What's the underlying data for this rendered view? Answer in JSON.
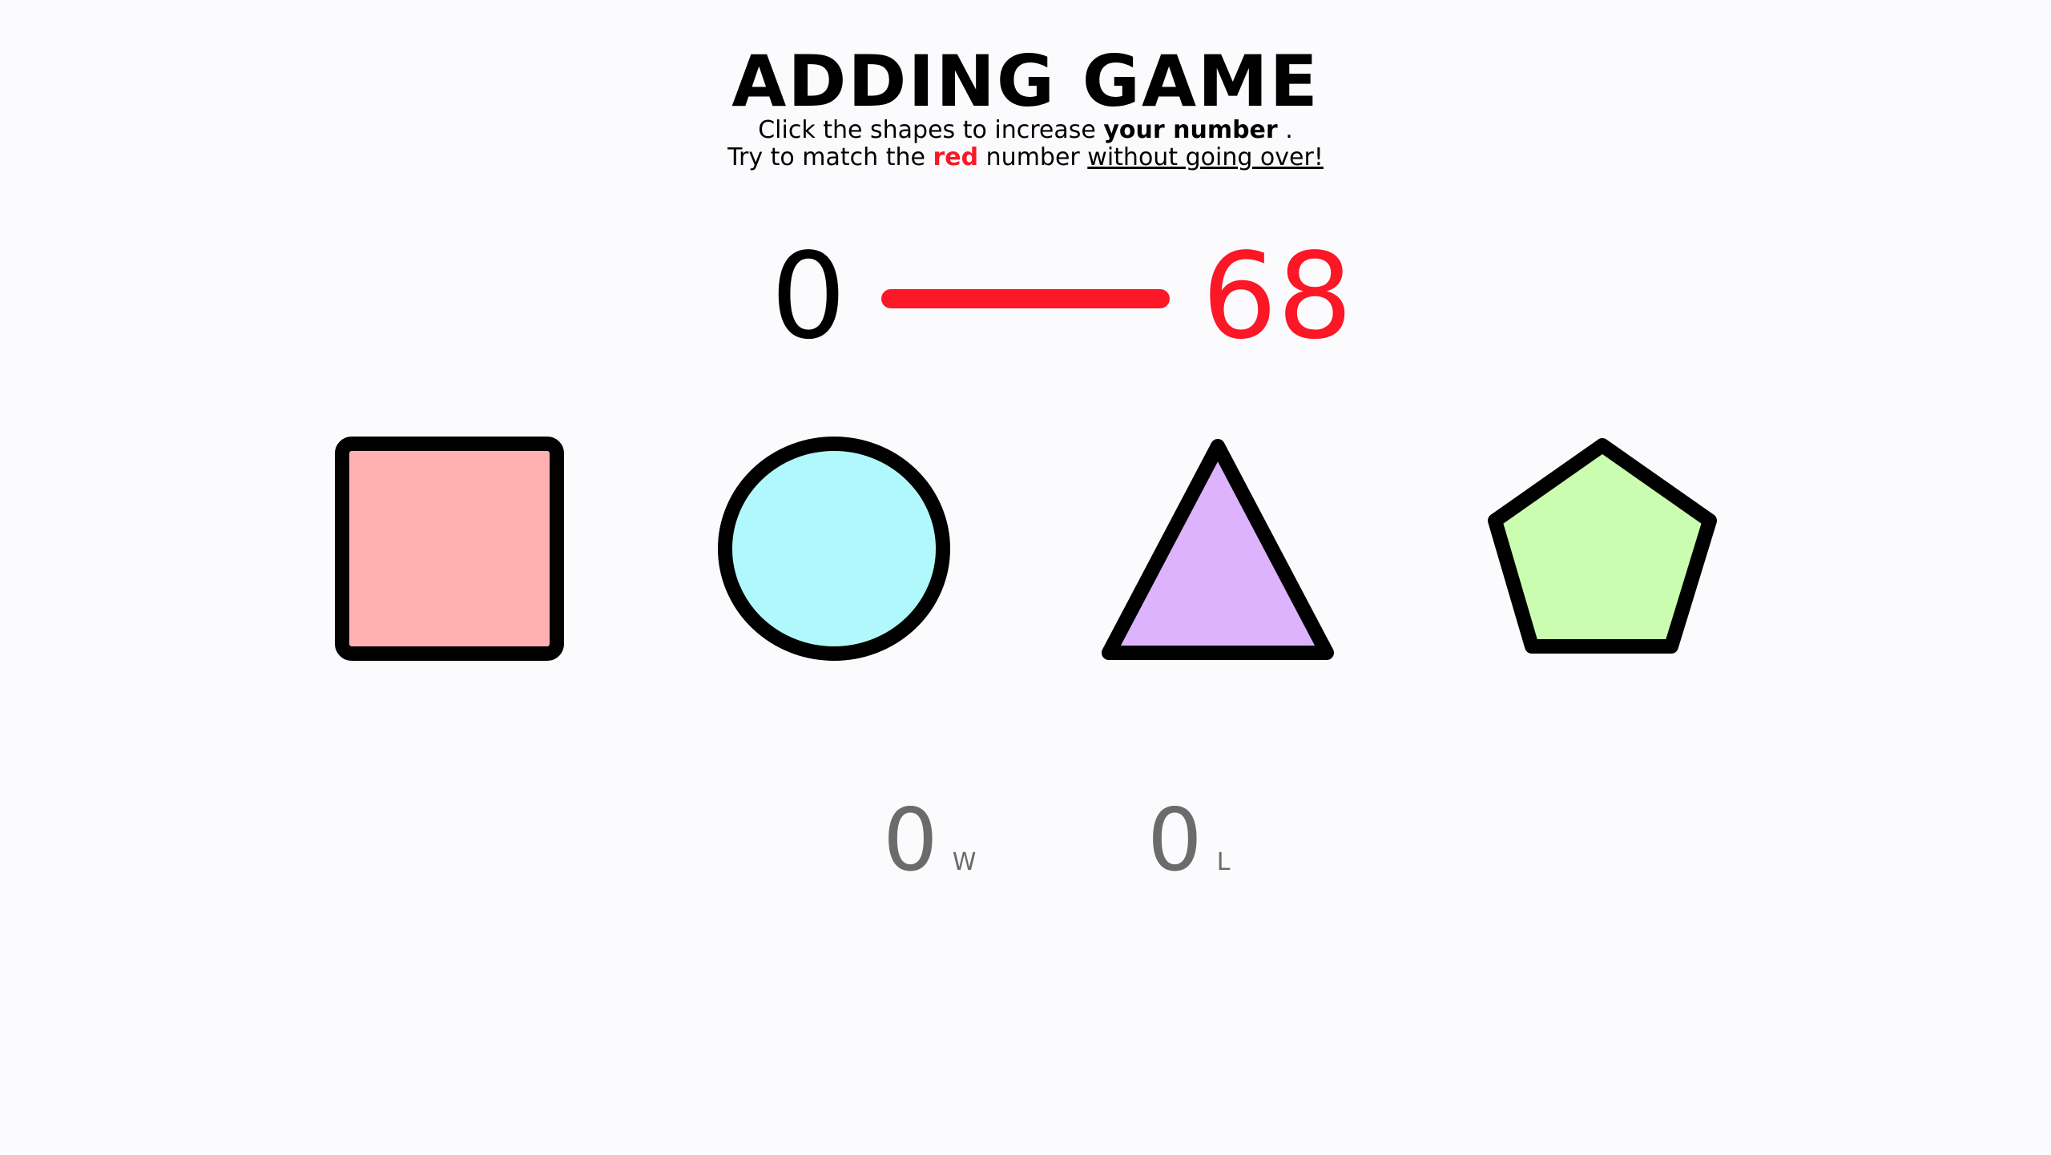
{
  "title": "ADDING GAME",
  "instructions": {
    "line1_before": "Click the shapes to increase ",
    "line1_bold": "your number",
    "line1_after": " .",
    "line2_before": "Try to match the ",
    "line2_red": "red",
    "line2_middle": " number ",
    "line2_underline": "without going over!"
  },
  "score": {
    "current": "0",
    "target": "68"
  },
  "shapes": [
    {
      "name": "square",
      "fill": "#ffb1b1"
    },
    {
      "name": "circle",
      "fill": "#b1f8fc"
    },
    {
      "name": "triangle",
      "fill": "#dcb3fc"
    },
    {
      "name": "pentagon",
      "fill": "#cafdb0"
    }
  ],
  "tally": {
    "wins": "0",
    "wins_label": "W",
    "losses": "0",
    "losses_label": "L"
  },
  "colors": {
    "accent_red": "#fb1726",
    "outline": "#000000",
    "tally_gray": "#6b6b6b",
    "background": "#fbfbfd"
  }
}
